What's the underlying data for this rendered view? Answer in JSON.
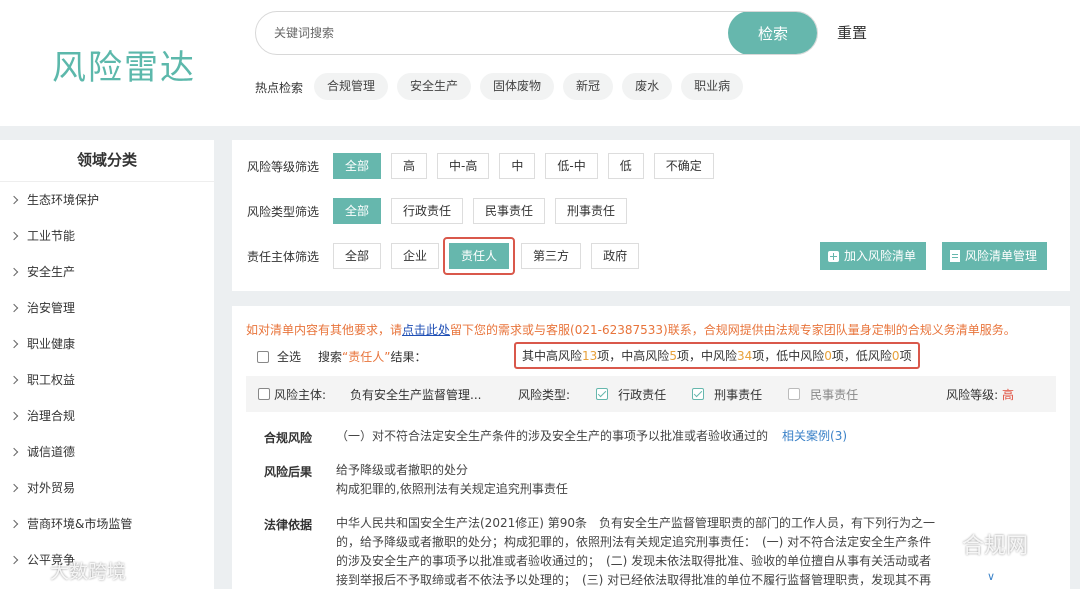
{
  "header": {
    "logo": "风险雷达",
    "search_placeholder": "关键词搜索",
    "search_button": "检索",
    "reset_button": "重置",
    "hot_label": "热点检索",
    "hot_tags": [
      "合规管理",
      "安全生产",
      "固体废物",
      "新冠",
      "废水",
      "职业病"
    ]
  },
  "sidebar": {
    "title": "领域分类",
    "items": [
      "生态环境保护",
      "工业节能",
      "安全生产",
      "治安管理",
      "职业健康",
      "职工权益",
      "治理合规",
      "诚信道德",
      "对外贸易",
      "营商环境&市场监管",
      "公平竞争"
    ]
  },
  "filters": {
    "level": {
      "label": "风险等级筛选",
      "options": [
        "全部",
        "高",
        "中-高",
        "中",
        "低-中",
        "低",
        "不确定"
      ]
    },
    "type": {
      "label": "风险类型筛选",
      "options": [
        "全部",
        "行政责任",
        "民事责任",
        "刑事责任"
      ]
    },
    "subject": {
      "label": "责任主体筛选",
      "options": [
        "全部",
        "企业",
        "责任人",
        "第三方",
        "政府"
      ]
    },
    "add_button": "加入风险清单",
    "manage_button": "风险清单管理"
  },
  "results": {
    "notice_pre": "如对清单内容有其他要求，请",
    "notice_link": "点击此处",
    "notice_post": "留下您的需求或与客服(021-62387533)联系，合规网提供由法规专家团队量身定制的合规义务清单服务。",
    "select_all": "全选",
    "search_prefix": "搜索",
    "search_keyword": "“责任人”",
    "search_suffix": "结果：",
    "summary": {
      "p1": "其中高风险",
      "n1": "13",
      "p2": "项，中高风险",
      "n2": "5",
      "p3": "项，中风险",
      "n3": "34",
      "p4": "项，低中风险",
      "n4": "0",
      "p5": "项，低风险",
      "n5": "0",
      "p6": "项"
    },
    "item": {
      "subject_label": "风险主体:",
      "subject_value": "负有安全生产监督管理...",
      "type_label": "风险类型:",
      "types": [
        "行政责任",
        "刑事责任",
        "民事责任"
      ],
      "level_label": "风险等级:",
      "level_value": "高",
      "risk_label": "合规风险",
      "risk_text": "（一）对不符合法定安全生产条件的涉及安全生产的事项予以批准或者验收通过的",
      "case_link": "相关案例(3)",
      "consequence_label": "风险后果",
      "consequence_1": "给予降级或者撤职的处分",
      "consequence_2": "构成犯罪的,依照刑法有关规定追究刑事责任",
      "basis_label": "法律依据",
      "basis_1": "中华人民共和国安全生产法(2021修正) 第90条　负有安全生产监督管理职责的部门的工作人员，有下列行为之一",
      "basis_2": "的，给予降级或者撤职的处分；构成犯罪的，依照刑法有关规定追究刑事责任：　(一) 对不符合法定安全生产条件",
      "basis_3": "的涉及安全生产的事项予以批准或者验收通过的；　(二) 发现未依法取得批准、验收的单位擅自从事有关活动或者",
      "basis_4": "接到举报后不予取缔或者不依法予以处理的；　(三) 对已经依法取得批准的单位不履行监督管理职责，发现其不再"
    }
  },
  "watermarks": {
    "right": "合规网",
    "left": "大数跨境"
  }
}
